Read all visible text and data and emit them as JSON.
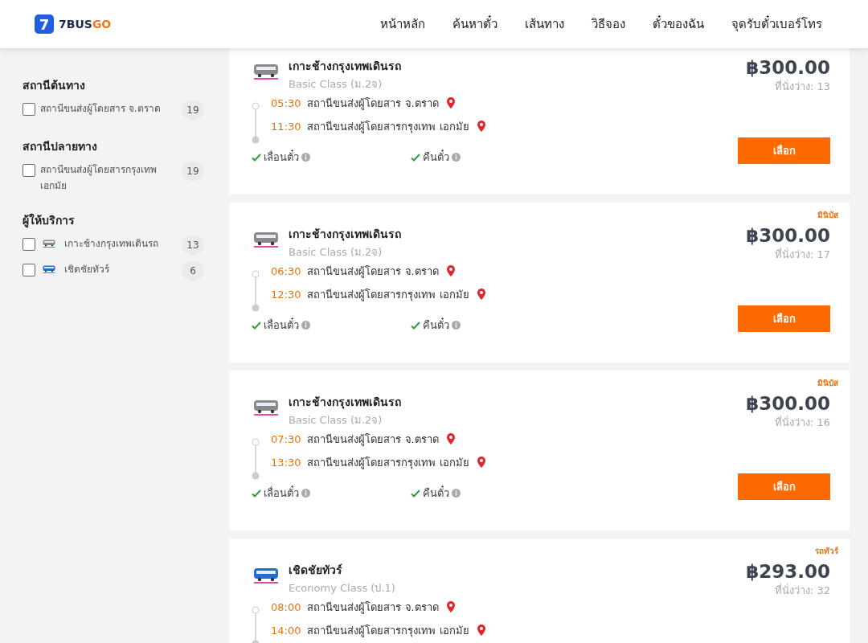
{
  "header": {
    "logo": {
      "mark": "7",
      "word_a": "7BUS",
      "word_b": "GO"
    },
    "nav": [
      {
        "label": "หน้าหลัก"
      },
      {
        "label": "ค้นหาตั๋ว"
      },
      {
        "label": "เส้นทาง"
      },
      {
        "label": "วิธีจอง"
      },
      {
        "label": "ตั๋วของฉัน"
      },
      {
        "label": "จุดรับตั๋วเบอร์โทร"
      }
    ]
  },
  "sidebar": {
    "groups": [
      {
        "title": "สถานีต้นทาง",
        "items": [
          {
            "label": "สถานีขนส่งผู้โดยสาร จ.ตราด",
            "count": "19",
            "checked": false
          }
        ]
      },
      {
        "title": "สถานีปลายทาง",
        "items": [
          {
            "label": "สถานีขนส่งผู้โดยสารกรุงเทพ เอกมัย",
            "count": "19",
            "checked": false
          }
        ]
      },
      {
        "title": "ผู้ให้บริการ",
        "items": [
          {
            "label": "เกาะช้างกรุงเทพเดินรถ",
            "count": "13",
            "checked": false,
            "color": "#8a8a8a"
          },
          {
            "label": "เชิดชัยทัวร์",
            "count": "6",
            "checked": false,
            "color": "#1f6fd0"
          }
        ]
      }
    ]
  },
  "trips": [
    {
      "operator": "เกาะช้างกรุงเทพเดินรถ",
      "color": "#8a8a8a",
      "class": "Basic Class (ม.2จ)",
      "price": "฿300.00",
      "seats": "ที่นั่งว่าง: 13",
      "depart_time": "05:30",
      "depart_station": "สถานีขนส่งผู้โดยสาร จ.ตราด",
      "arrive_time": "11:30",
      "arrive_station": "สถานีขนส่งผู้โดยสารกรุงเทพ เอกมัย",
      "features": [
        "เลื่อนตั๋ว",
        "คืนตั๋ว"
      ],
      "button": "เลือก"
    },
    {
      "badge": "มินิบัส",
      "operator": "เกาะช้างกรุงเทพเดินรถ",
      "color": "#8a8a8a",
      "class": "Basic Class (ม.2จ)",
      "price": "฿300.00",
      "seats": "ที่นั่งว่าง: 17",
      "depart_time": "06:30",
      "depart_station": "สถานีขนส่งผู้โดยสาร จ.ตราด",
      "arrive_time": "12:30",
      "arrive_station": "สถานีขนส่งผู้โดยสารกรุงเทพ เอกมัย",
      "features": [
        "เลื่อนตั๋ว",
        "คืนตั๋ว"
      ],
      "button": "เลือก"
    },
    {
      "badge": "มินิบัส",
      "operator": "เกาะช้างกรุงเทพเดินรถ",
      "color": "#8a8a8a",
      "class": "Basic Class (ม.2จ)",
      "price": "฿300.00",
      "seats": "ที่นั่งว่าง: 16",
      "depart_time": "07:30",
      "depart_station": "สถานีขนส่งผู้โดยสาร จ.ตราด",
      "arrive_time": "13:30",
      "arrive_station": "สถานีขนส่งผู้โดยสารกรุงเทพ เอกมัย",
      "features": [
        "เลื่อนตั๋ว",
        "คืนตั๋ว"
      ],
      "button": "เลือก"
    },
    {
      "badge": "รถทัวร์",
      "operator": "เชิดชัยทัวร์",
      "color": "#1f6fd0",
      "class": "Economy Class (ป.1)",
      "price": "฿293.00",
      "seats": "ที่นั่งว่าง: 32",
      "depart_time": "08:00",
      "depart_station": "สถานีขนส่งผู้โดยสาร จ.ตราด",
      "arrive_time": "14:00",
      "arrive_station": "สถานีขนส่งผู้โดยสารกรุงเทพ เอกมัย"
    }
  ]
}
